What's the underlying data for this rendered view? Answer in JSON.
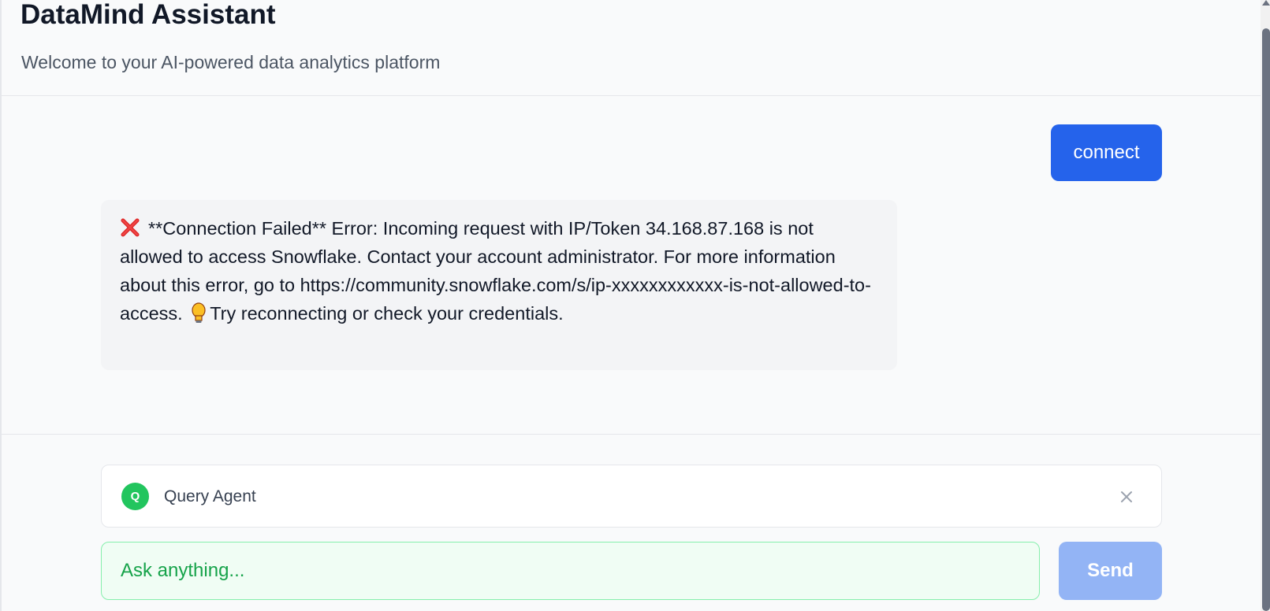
{
  "header": {
    "title": "DataMind Assistant",
    "subtitle": "Welcome to your AI-powered data analytics platform"
  },
  "chat": {
    "user_message": "connect",
    "bot_message": {
      "icon_start": "cross-mark-icon",
      "text_part1": "**Connection Failed** Error: Incoming request with IP/Token 34.168.87.168 is not allowed to access Snowflake. Contact your account administrator. For more information about this error, go to https://community.snowflake.com/s/ip-xxxxxxxxxxxx-is-not-allowed-to-access.",
      "icon_mid": "light-bulb-icon",
      "text_part2": "Try reconnecting or check your credentials."
    }
  },
  "agent": {
    "avatar_letter": "Q",
    "name": "Query Agent",
    "close_icon": "close-icon"
  },
  "input": {
    "placeholder": "Ask anything...",
    "value": ""
  },
  "send": {
    "label": "Send"
  },
  "colors": {
    "primary": "#2563eb",
    "send_disabled": "#93b4f5",
    "agent_green": "#22c55e",
    "input_border": "#86efac",
    "error_red": "#dc2626"
  }
}
